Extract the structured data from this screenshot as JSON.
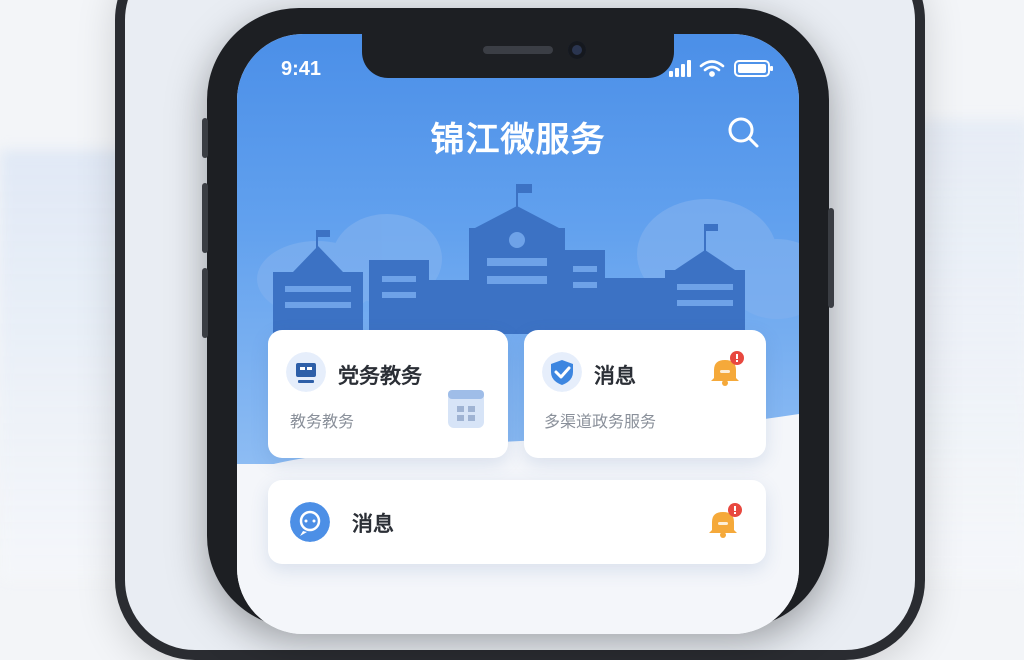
{
  "status_bar": {
    "time": "9:41"
  },
  "header": {
    "title": "锦江微服务",
    "search_icon": "search-icon"
  },
  "cards": {
    "affairs": {
      "title": "党务教务",
      "subtitle": "教务教务",
      "icon": "monitor-icon",
      "side_icon": "grid-app-icon"
    },
    "messages_top": {
      "title": "消息",
      "subtitle": "多渠道政务服务",
      "icon": "shield-check-icon",
      "badge_icon": "bell-alert-icon"
    },
    "messages_bottom": {
      "title": "消息",
      "icon": "chat-bubble-icon",
      "badge_icon": "bell-alert-icon"
    }
  },
  "colors": {
    "hero_top": "#4b8fe8",
    "hero_bottom": "#8dbcf3",
    "skyline": "#3c72c4",
    "badge_red": "#e8483f",
    "bell_orange": "#f5a93a"
  }
}
